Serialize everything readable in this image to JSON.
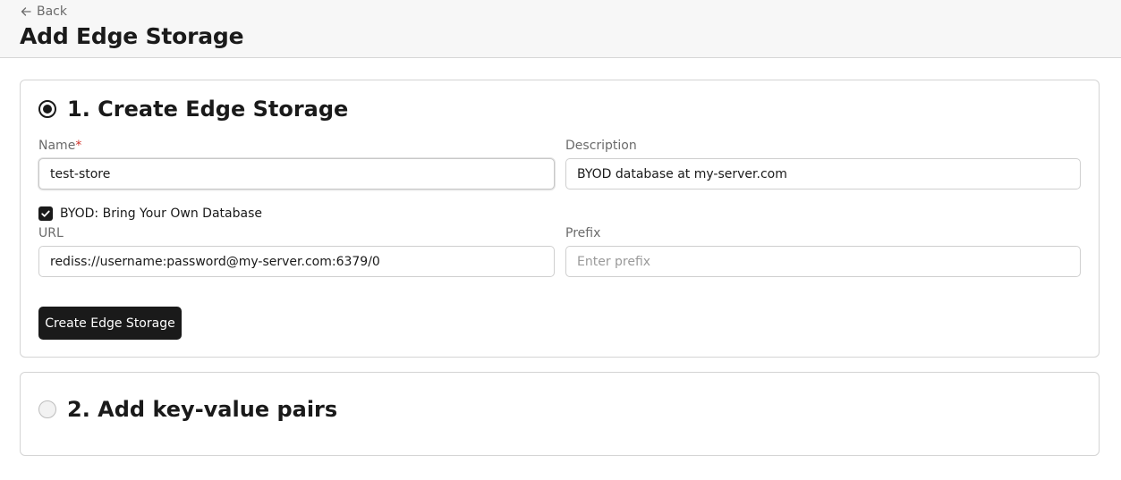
{
  "header": {
    "back_label": "Back",
    "title": "Add Edge Storage"
  },
  "step1": {
    "title": "1. Create Edge Storage",
    "selected": true,
    "name": {
      "label": "Name",
      "required_mark": "*",
      "value": "test-store"
    },
    "description": {
      "label": "Description",
      "value": "BYOD database at my-server.com"
    },
    "byod": {
      "label": "BYOD: Bring Your Own Database",
      "checked": true
    },
    "url": {
      "label": "URL",
      "value": "rediss://username:password@my-server.com:6379/0"
    },
    "prefix": {
      "label": "Prefix",
      "value": "",
      "placeholder": "Enter prefix"
    },
    "submit_label": "Create Edge Storage"
  },
  "step2": {
    "title": "2. Add key-value pairs",
    "selected": false
  },
  "colors": {
    "primary": "#1a1a1a",
    "required": "#d0342c",
    "label": "#6b6b6b"
  }
}
